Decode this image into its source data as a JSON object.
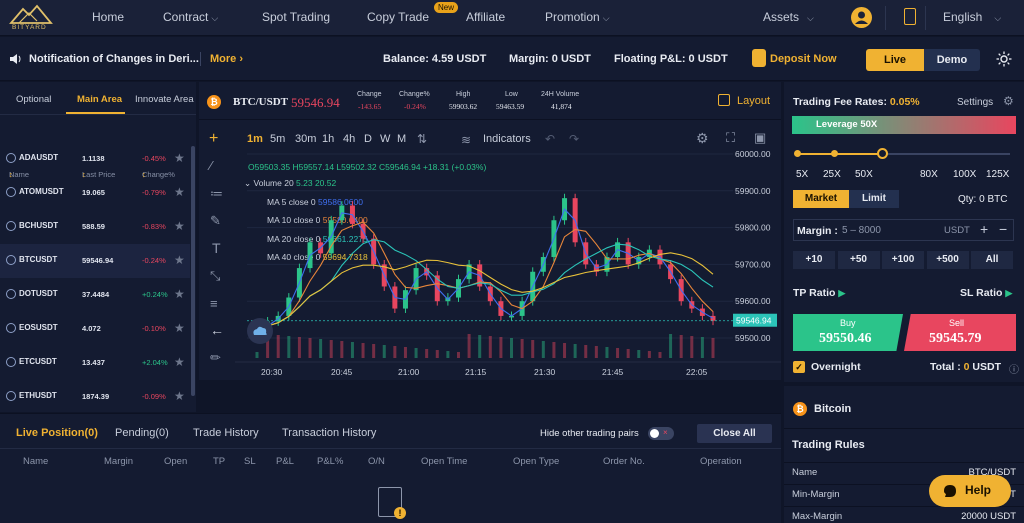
{
  "nav": {
    "logo_text": "BITYARD",
    "home": "Home",
    "contract": "Contract",
    "spot_trading": "Spot Trading",
    "copy_trade": "Copy Trade",
    "new_badge": "New",
    "affiliate": "Affiliate",
    "promotion": "Promotion",
    "assets": "Assets",
    "language": "English"
  },
  "notice": {
    "text": "Notification of Changes in Deri...",
    "more": "More",
    "balance": "Balance: 4.59 USDT",
    "margin": "Margin: 0 USDT",
    "pnl": "Floating P&L: 0 USDT",
    "deposit": "Deposit Now",
    "live": "Live",
    "demo": "Demo"
  },
  "market": {
    "tabs": [
      "Optional",
      "Main Area",
      "Innovate Area"
    ],
    "headers": [
      "Name",
      "Last Price",
      "Change%"
    ],
    "rows": [
      {
        "symbol": "ADAUSDT",
        "price": "1.1138",
        "change": "-0.45%",
        "up": false
      },
      {
        "symbol": "ATOMUSDT",
        "price": "19.065",
        "change": "-0.79%",
        "up": false
      },
      {
        "symbol": "BCHUSDT",
        "price": "588.59",
        "change": "-0.83%",
        "up": false
      },
      {
        "symbol": "BTCUSDT",
        "price": "59546.94",
        "change": "-0.24%",
        "up": false
      },
      {
        "symbol": "DOTUSDT",
        "price": "37.4484",
        "change": "+0.24%",
        "up": true
      },
      {
        "symbol": "EOSUSDT",
        "price": "4.072",
        "change": "-0.10%",
        "up": false
      },
      {
        "symbol": "ETCUSDT",
        "price": "13.437",
        "change": "+2.04%",
        "up": true
      },
      {
        "symbol": "ETHUSDT",
        "price": "1874.39",
        "change": "-0.09%",
        "up": false
      }
    ]
  },
  "ticker": {
    "pair": "BTC/USDT",
    "price": "59546.94",
    "change_label": "Change",
    "change_value": "-143.65",
    "changepct_label": "Change%",
    "changepct_value": "-0.24%",
    "high_label": "High",
    "high_value": "59903.62",
    "low_label": "Low",
    "low_value": "59463.59",
    "vol_label": "24H Volume",
    "vol_value": "41,874",
    "layout": "Layout"
  },
  "chart_toolbar": {
    "intervals": [
      "1m",
      "5m",
      "30m",
      "1h",
      "4h",
      "D",
      "W",
      "M"
    ],
    "indicators": "Indicators"
  },
  "chart_legend": {
    "ohlc_o": "O59503.35",
    "ohlc_h": "H59557.14",
    "ohlc_l": "L59502.32",
    "ohlc_c": "C59546.94",
    "ohlc_chg": "+18.31 (+0.03%)",
    "volume": "Volume 20",
    "volume_vals": "5.23  20.52",
    "ma5_label": "MA 5 close 0",
    "ma5_val": "59586.0600",
    "ma10_label": "MA 10 close 0",
    "ma10_val": "59580.6400",
    "ma20_label": "MA 20 close 0",
    "ma20_val": "59661.2275",
    "ma40_label": "MA 40 close 0",
    "ma40_val": "59694.7318"
  },
  "chart_data": {
    "type": "line",
    "series": [
      {
        "values": [
          59520,
          59545,
          59560,
          59610,
          59690,
          59760,
          59730,
          59820,
          59860,
          59810,
          59770,
          59700,
          59640,
          59580,
          59630,
          59690,
          59670,
          59600,
          59610,
          59660,
          59700,
          59640,
          59600,
          59560,
          59560,
          59600,
          59680,
          59720,
          59820,
          59880,
          59760,
          59700,
          59680,
          59720,
          59760,
          59700,
          59720,
          59740,
          59700,
          59660,
          59600,
          59580,
          59560,
          59546.94
        ]
      }
    ],
    "ylim": [
      59500,
      60000
    ],
    "y_ticks": [
      "60000.00",
      "59900.00",
      "59800.00",
      "59700.00",
      "59600.00",
      "59500.00"
    ],
    "x_ticks": [
      "20:30",
      "20:45",
      "21:00",
      "21:15",
      "21:30",
      "21:45",
      "22:05"
    ],
    "last_price_label": "59546.94"
  },
  "positions": {
    "tabs": [
      "Live Position(0)",
      "Pending(0)",
      "Trade History",
      "Transaction History"
    ],
    "hide_label": "Hide other trading pairs",
    "close_all": "Close All",
    "columns": [
      "Name",
      "Margin",
      "Open",
      "TP",
      "SL",
      "P&L",
      "P&L%",
      "O/N",
      "Open Time",
      "Open Type",
      "Order No.",
      "Operation"
    ]
  },
  "trade": {
    "fee_label": "Trading Fee Rates:",
    "fee_value": "0.05%",
    "settings": "Settings",
    "leverage": "Leverage 50X",
    "lev_levels": [
      "5X",
      "25X",
      "50X",
      "80X",
      "100X",
      "125X"
    ],
    "lev_position": 0.4,
    "market": "Market",
    "limit": "Limit",
    "qty": "Qty: 0 BTC",
    "margin_label": "Margin :",
    "margin_placeholder": "5 – 8000",
    "margin_unit": "USDT",
    "quick": [
      "+10",
      "+50",
      "+100",
      "+500",
      "All"
    ],
    "tp_ratio": "TP Ratio",
    "sl_ratio": "SL Ratio",
    "buy_label": "Buy",
    "buy_price": "59550.46",
    "sell_label": "Sell",
    "sell_price": "59545.79",
    "overnight": "Overnight",
    "total_label": "Total :",
    "total_value": "0",
    "total_unit": "USDT"
  },
  "info": {
    "coin": "Bitcoin",
    "rules_title": "Trading Rules",
    "rules": [
      {
        "label": "Name",
        "value": "BTC/USDT"
      },
      {
        "label": "Min-Margin",
        "value": "5 USDT"
      },
      {
        "label": "Max-Margin",
        "value": "20000 USDT"
      }
    ],
    "help": "Help"
  },
  "colors": {
    "accent": "#f0b232",
    "up": "#2bc48a",
    "down": "#e8465f",
    "bg": "#0f1528",
    "panel": "#141b31"
  }
}
